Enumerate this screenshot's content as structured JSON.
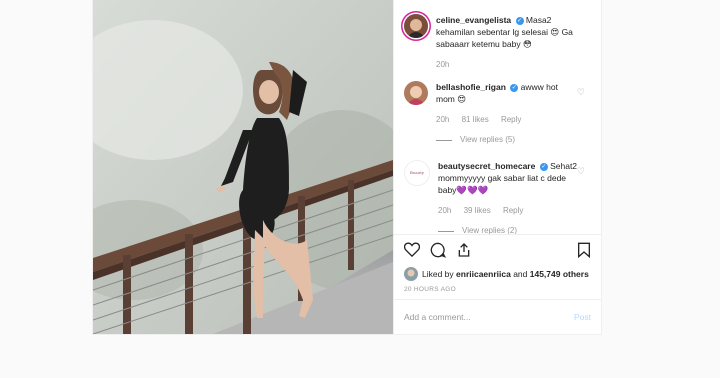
{
  "post": {
    "caption": {
      "username": "celine_evangelista",
      "text": "Masa2 kehamilan sebentar lg selesai 😍 Ga sabaaarr ketemu baby 😳",
      "time": "20h"
    },
    "comments": [
      {
        "username": "bellashofie_rigan",
        "text": "awww hot mom 😍",
        "time": "20h",
        "likes": "81 likes",
        "reply": "Reply",
        "view_replies": "View replies (5)"
      },
      {
        "username": "beautysecret_homecare",
        "text": "Sehat2 mommyyyyy gak sabar liat c dede baby💜💜💜",
        "time": "20h",
        "likes": "39 likes",
        "reply": "Reply",
        "view_replies": "View replies (2)"
      }
    ],
    "liked_by": {
      "prefix": "Liked by ",
      "user": "enriicaenriica",
      "mid": " and ",
      "others": "145,749 others"
    },
    "timestamp": "20 HOURS AGO",
    "add_comment_placeholder": "Add a comment...",
    "post_button": "Post"
  },
  "colors": {
    "link": "#3897f0",
    "story_ring": "#d6249f",
    "muted": "#999999"
  },
  "icons": [
    "heart-icon",
    "comment-icon",
    "share-icon",
    "bookmark-icon",
    "verified-badge-icon"
  ]
}
